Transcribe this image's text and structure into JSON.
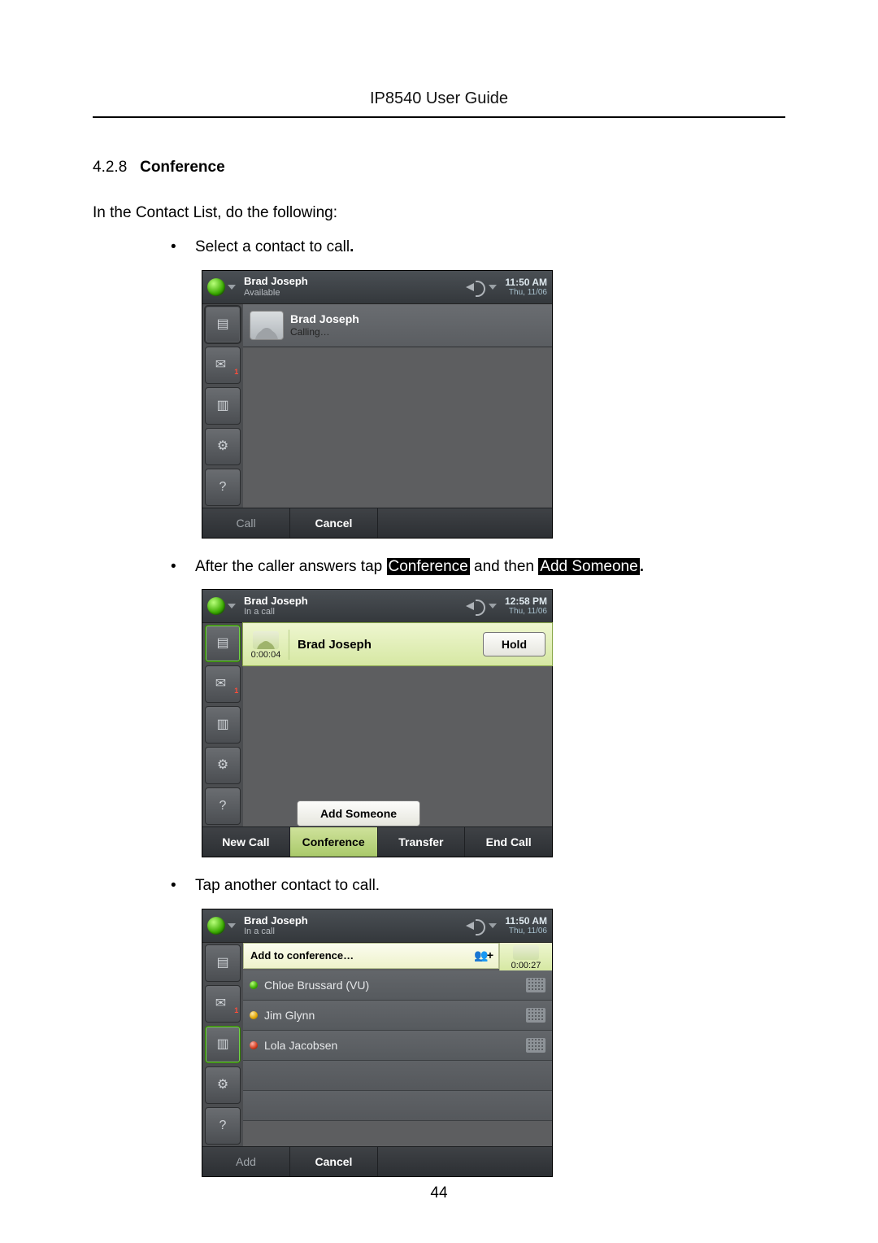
{
  "doc": {
    "title": "IP8540 User Guide",
    "section_no": "4.2.8",
    "section_title": "Conference",
    "intro": "In the Contact List, do the following:",
    "bullet1": "Select a contact to call",
    "bullet2_pre": "After the caller answers tap ",
    "bullet2_hl1": "Conference",
    "bullet2_mid": " and then ",
    "bullet2_hl2": "Add Someone",
    "bullet3": "Tap another contact to call.",
    "page_no": "44"
  },
  "shot1": {
    "user_name": "Brad Joseph",
    "user_status": "Available",
    "time": "11:50 AM",
    "date": "Thu, 11/06",
    "call_name": "Brad Joseph",
    "call_status": "Calling…",
    "soft_call": "Call",
    "soft_cancel": "Cancel"
  },
  "shot2": {
    "user_name": "Brad Joseph",
    "user_status": "In a call",
    "time": "12:58 PM",
    "date": "Thu, 11/06",
    "elapsed": "0:00:04",
    "call_name": "Brad Joseph",
    "hold": "Hold",
    "add_someone": "Add Someone",
    "soft_newcall": "New Call",
    "soft_conference": "Conference",
    "soft_transfer": "Transfer",
    "soft_endcall": "End Call"
  },
  "shot3": {
    "user_name": "Brad Joseph",
    "user_status": "In a call",
    "time": "11:50 AM",
    "date": "Thu, 11/06",
    "header": "Add to conference…",
    "elapsed": "0:00:27",
    "contacts": {
      "0": "Chloe Brussard (VU)",
      "1": "Jim Glynn",
      "2": "Lola Jacobsen"
    },
    "soft_add": "Add",
    "soft_cancel": "Cancel"
  }
}
